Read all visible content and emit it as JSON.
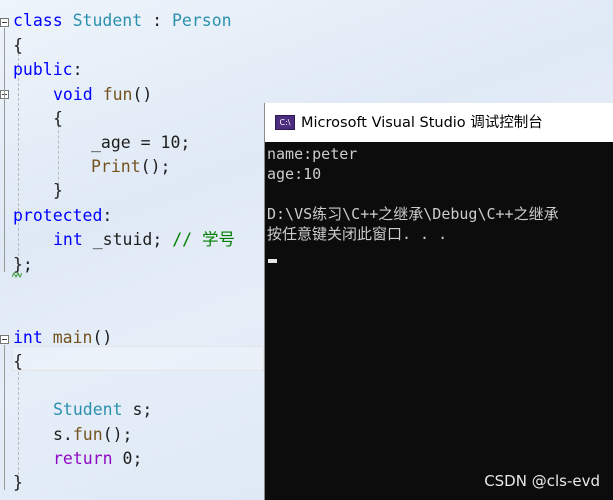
{
  "code_lines": {
    "l1": {
      "kw": "class",
      "name": "Student",
      "sep": " : ",
      "base": "Person"
    },
    "l2": "{",
    "l3": "public",
    "l3_colon": ":",
    "l4": {
      "kw": "void",
      "fn": "fun",
      "rest": "()"
    },
    "l5": "{",
    "l6": {
      "var": "_age",
      "rest": " = 10;"
    },
    "l7": {
      "fn": "Print",
      "rest": "();"
    },
    "l8": "}",
    "l9": "protected",
    "l9_colon": ":",
    "l10": {
      "kw": "int",
      "var": "_stuid;",
      "comment": "// 学号"
    },
    "l11": "};",
    "l12": {
      "kw": "int",
      "fn": "main",
      "rest": "()"
    },
    "l13": "{",
    "l14": {
      "type": "Student",
      "rest": " s;"
    },
    "l15": {
      "obj": "s.",
      "fn": "fun",
      "rest": "();"
    },
    "l16": {
      "kw": "return",
      "rest": " 0;"
    },
    "l17": "}"
  },
  "console": {
    "title": "Microsoft Visual Studio 调试控制台",
    "icon_text": "C:\\",
    "lines": [
      "name:peter",
      "age:10",
      "",
      "D:\\VS练习\\C++之继承\\Debug\\C++之继承",
      "按任意键关闭此窗口. . ."
    ]
  },
  "watermark": "CSDN @cls-evd",
  "colors": {
    "keyword": "#0000ff",
    "type": "#2b91af",
    "function": "#74531f",
    "comment": "#008000",
    "console_bg": "#0c0c0c",
    "console_text": "#cccccc"
  }
}
